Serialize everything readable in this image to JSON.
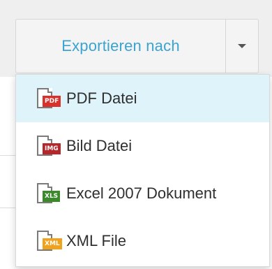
{
  "export_button": {
    "label": "Exportieren nach"
  },
  "menu": {
    "items": [
      {
        "label": "PDF Datei",
        "icon": "pdf-file-icon",
        "badge": "PDF",
        "color": "#d9302b",
        "active": true
      },
      {
        "label": "Bild Datei",
        "icon": "image-file-icon",
        "badge": "IMG",
        "color": "#b5272a",
        "active": false
      },
      {
        "label": "Excel 2007 Dokument",
        "icon": "excel-file-icon",
        "badge": "XLS",
        "color": "#3a8a2c",
        "active": false
      },
      {
        "label": "XML File",
        "icon": "xml-file-icon",
        "badge": "XML",
        "color": "#f0a21c",
        "active": false
      }
    ]
  },
  "colors": {
    "accent": "#3ba3d0",
    "active_item_bg": "#dff3fa"
  }
}
